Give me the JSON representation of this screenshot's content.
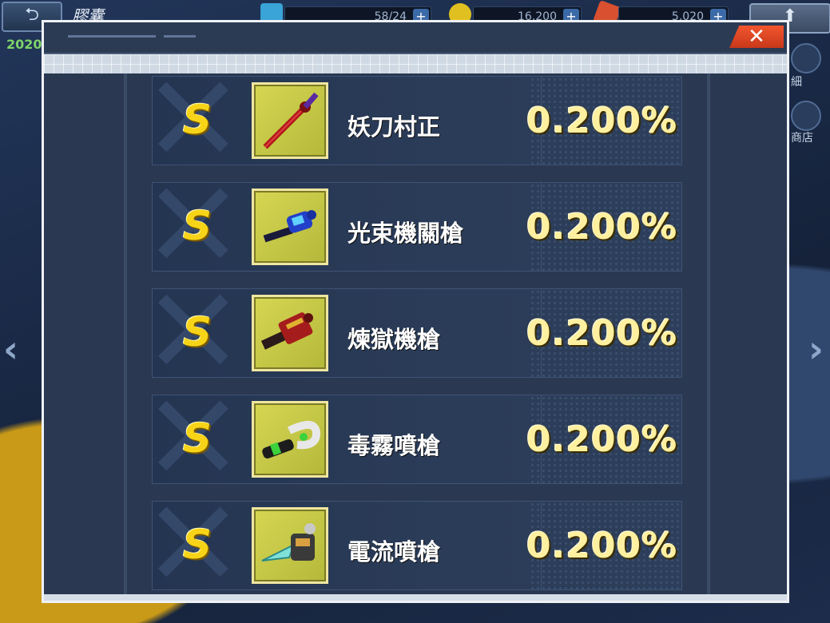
{
  "background": {
    "top_title": "膠囊",
    "year_label": "2020",
    "resources": [
      {
        "icon": "battery-icon",
        "value": "58/24",
        "color": "#3aa3d8"
      },
      {
        "icon": "zenny-coin-icon",
        "value": "16,200",
        "color": "#e0c020"
      },
      {
        "icon": "gem-icon",
        "value": "5,020",
        "color": "#d85030"
      }
    ],
    "plus_symbol": "+",
    "side_labels": {
      "detail": "細",
      "shop": "商店"
    }
  },
  "modal": {
    "close_symbol": "✕",
    "items": [
      {
        "rank": "S",
        "name": "妖刀村正",
        "rate": "0.200%",
        "icon": "katana-icon"
      },
      {
        "rank": "S",
        "name": "光束機關槍",
        "rate": "0.200%",
        "icon": "beam-gatling-icon"
      },
      {
        "rank": "S",
        "name": "煉獄機槍",
        "rate": "0.200%",
        "icon": "inferno-minigun-icon"
      },
      {
        "rank": "S",
        "name": "毒霧噴槍",
        "rate": "0.200%",
        "icon": "poison-spray-gun-icon"
      },
      {
        "rank": "S",
        "name": "電流噴槍",
        "rate": "0.200%",
        "icon": "electric-spray-gun-icon"
      }
    ]
  },
  "colors": {
    "rank_yellow": "#f7d417",
    "rate_text": "#fff0a0",
    "close_red": "#e8482a",
    "icon_frame": "#c9c94a"
  }
}
